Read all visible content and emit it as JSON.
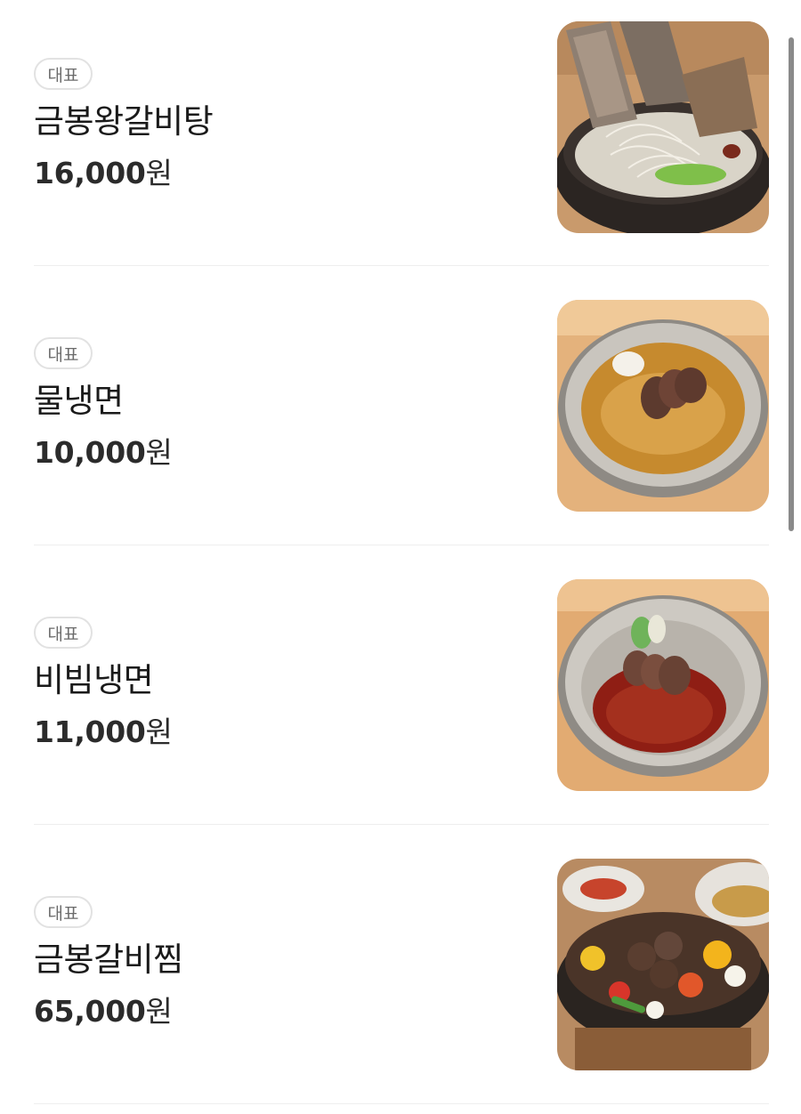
{
  "menu": {
    "items": [
      {
        "badge": "대표",
        "name": "금봉왕갈비탕",
        "price": "16,000",
        "currency": "원",
        "image": "galbitang-photo"
      },
      {
        "badge": "대표",
        "name": "물냉면",
        "price": "10,000",
        "currency": "원",
        "image": "mul-naengmyeon-photo"
      },
      {
        "badge": "대표",
        "name": "비빔냉면",
        "price": "11,000",
        "currency": "원",
        "image": "bibim-naengmyeon-photo"
      },
      {
        "badge": "대표",
        "name": "금봉갈비찜",
        "price": "65,000",
        "currency": "원",
        "image": "galbijjim-photo"
      }
    ]
  },
  "colors": {
    "text": "#1a1a1a",
    "badge_border": "#e2e2e2",
    "badge_text": "#6b6b6b",
    "divider": "#eeeeee",
    "scrollbar": "#8a8a8a"
  }
}
